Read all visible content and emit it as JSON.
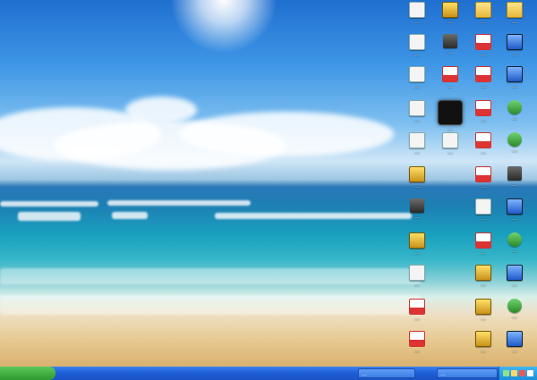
{
  "desktop": {
    "icons": [
      {
        "id": "r0c0",
        "label": "…",
        "icon": "doc-icon"
      },
      {
        "id": "r0c1",
        "label": "…",
        "icon": "gold-app-icon"
      },
      {
        "id": "r0c2",
        "label": "…",
        "icon": "folder-icon"
      },
      {
        "id": "r0c3",
        "label": "…",
        "icon": "folder-icon"
      },
      {
        "id": "r1c0",
        "label": "…",
        "icon": "doc-icon"
      },
      {
        "id": "r1c1",
        "label": "…",
        "icon": "dark-app-icon"
      },
      {
        "id": "r1c2",
        "label": "…",
        "icon": "red-doc-icon"
      },
      {
        "id": "r1c3",
        "label": "…",
        "icon": "blue-app-icon"
      },
      {
        "id": "r2c0",
        "label": "…",
        "icon": "doc-icon"
      },
      {
        "id": "r2c1",
        "label": "…",
        "icon": "red-doc-icon"
      },
      {
        "id": "r2c2",
        "label": "…",
        "icon": "red-doc-icon"
      },
      {
        "id": "r2c3",
        "label": "…",
        "icon": "blue-app-icon"
      },
      {
        "id": "r3c0",
        "label": "…",
        "icon": "doc-icon"
      },
      {
        "id": "r3c1",
        "label": "…",
        "icon": "video-thumbnail-icon"
      },
      {
        "id": "r3c2",
        "label": "…",
        "icon": "red-doc-icon"
      },
      {
        "id": "r3c3",
        "label": "…",
        "icon": "green-app-icon"
      },
      {
        "id": "r4c0",
        "label": "…",
        "icon": "doc-icon"
      },
      {
        "id": "r4c1",
        "label": "…",
        "icon": "doc-icon"
      },
      {
        "id": "r4c2",
        "label": "…",
        "icon": "red-doc-icon"
      },
      {
        "id": "r4c3",
        "label": "…",
        "icon": "green-app-icon"
      },
      {
        "id": "r5c0",
        "label": "…",
        "icon": "gold-app-icon"
      },
      {
        "id": "r5c1",
        "label": "…",
        "icon": "red-doc-icon"
      },
      {
        "id": "r5c2",
        "label": "…",
        "icon": "dark-app-icon"
      },
      {
        "id": "r6c0",
        "label": "…",
        "icon": "dark-app-icon"
      },
      {
        "id": "r6c1",
        "label": "…",
        "icon": "doc-icon"
      },
      {
        "id": "r6c2",
        "label": "…",
        "icon": "blue-app-icon"
      },
      {
        "id": "r7c0",
        "label": "…",
        "icon": "gold-app-icon"
      },
      {
        "id": "r7c1",
        "label": "…",
        "icon": "red-doc-icon"
      },
      {
        "id": "r7c2",
        "label": "…",
        "icon": "green-app-icon"
      },
      {
        "id": "r8c0",
        "label": "…",
        "icon": "doc-icon"
      },
      {
        "id": "r8c1",
        "label": "…",
        "icon": "gold-app-icon"
      },
      {
        "id": "r8c2",
        "label": "…",
        "icon": "blue-app-icon"
      },
      {
        "id": "r9c0",
        "label": "…",
        "icon": "red-doc-icon"
      },
      {
        "id": "r9c1",
        "label": "…",
        "icon": "gold-app-icon"
      },
      {
        "id": "r9c2",
        "label": "…",
        "icon": "green-app-icon"
      },
      {
        "id": "r10c0",
        "label": "…",
        "icon": "red-doc-icon"
      },
      {
        "id": "r10c1",
        "label": "…",
        "icon": "gold-app-icon"
      },
      {
        "id": "r10c2",
        "label": "…",
        "icon": "blue-app-icon"
      }
    ]
  },
  "taskbar": {
    "buttons": [
      {
        "label": "…"
      },
      {
        "label": "…"
      }
    ],
    "tray_color": "#1890dd"
  }
}
